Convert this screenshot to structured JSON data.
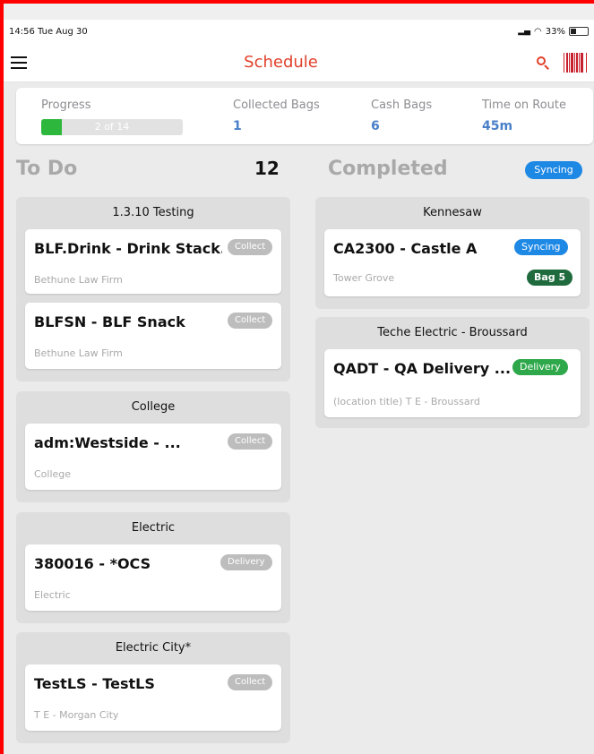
{
  "status_bar": {
    "time": "14:56",
    "date": "Tue Aug 30",
    "battery": "33%"
  },
  "navbar": {
    "title": "Schedule"
  },
  "summary": {
    "progress_label": "Progress",
    "progress_text": "2 of 14",
    "progress_fraction": 0.143,
    "collected_bags_label": "Collected Bags",
    "collected_bags_value": "1",
    "cash_bags_label": "Cash Bags",
    "cash_bags_value": "6",
    "time_on_route_label": "Time on Route",
    "time_on_route_value": "45m"
  },
  "todo": {
    "heading": "To Do",
    "count": "12",
    "groups": [
      {
        "title": "1.3.10 Testing",
        "cards": [
          {
            "title": "BLF.Drink - Drink Stack...",
            "sub": "Bethune Law Firm",
            "badge": "Collect"
          },
          {
            "title": "BLFSN - BLF Snack",
            "sub": "Bethune Law Firm",
            "badge": "Collect"
          }
        ]
      },
      {
        "title": "College",
        "cards": [
          {
            "title": "adm:Westside - ...",
            "sub": "College",
            "badge": "Collect"
          }
        ]
      },
      {
        "title": "Electric",
        "cards": [
          {
            "title": "380016 - *OCS",
            "sub": "Electric",
            "badge": "Delivery"
          }
        ]
      },
      {
        "title": "Electric City*",
        "cards": [
          {
            "title": "TestLS - TestLS",
            "sub": "T E - Morgan City",
            "badge": "Collect"
          }
        ]
      }
    ]
  },
  "completed": {
    "heading": "Completed",
    "sync_label": "Syncing",
    "groups": [
      {
        "title": "Kennesaw",
        "cards": [
          {
            "title": "CA2300 - Castle A",
            "sub": "Tower Grove",
            "badge": "Syncing",
            "badge2": "Bag 5"
          }
        ]
      },
      {
        "title": "Teche Electric - Broussard",
        "cards": [
          {
            "title": "QADT - QA Delivery ...",
            "sub": "(location title) T E - Broussard",
            "badge": "Delivery"
          }
        ]
      }
    ]
  },
  "colors": {
    "accent": "#e1402a",
    "value_blue": "#4a80c8",
    "progress_green": "#2db83d",
    "sync_blue": "#1e88e5",
    "delivery_green": "#2ea84a",
    "bag_green": "#1f6b3d"
  }
}
